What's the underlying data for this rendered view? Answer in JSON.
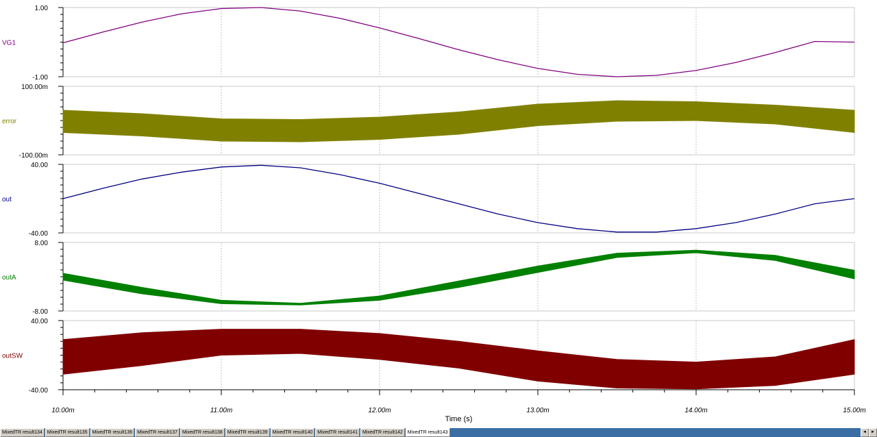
{
  "chart_data": {
    "type": "line",
    "xlabel": "Time (s)",
    "x_ticks": [
      "10.00m",
      "11.00m",
      "12.00m",
      "13.00m",
      "14.00m",
      "15.00m"
    ],
    "xlim": [
      0.01,
      0.015
    ],
    "panels": [
      {
        "name": "VG1",
        "color": "#800080",
        "render": "line",
        "ylim": [
          -1.0,
          1.0
        ],
        "y_tick_labels": [
          "1.00",
          "-1.00"
        ],
        "x": [
          0.01,
          0.01025,
          0.0105,
          0.01075,
          0.011,
          0.01125,
          0.0115,
          0.01175,
          0.012,
          0.01225,
          0.0125,
          0.01275,
          0.013,
          0.01325,
          0.0135,
          0.01375,
          0.014,
          0.01425,
          0.0145,
          0.01475,
          0.015
        ],
        "values": [
          -0.02,
          0.29,
          0.58,
          0.82,
          0.97,
          1.0,
          0.9,
          0.69,
          0.41,
          0.1,
          -0.22,
          -0.51,
          -0.76,
          -0.93,
          -1.0,
          -0.96,
          -0.82,
          -0.59,
          -0.3,
          0.02,
          0.0
        ]
      },
      {
        "name": "error",
        "color": "#808000",
        "render": "band",
        "ylim": [
          -100,
          100
        ],
        "y_tick_labels": [
          "100.00m",
          "-100.00m"
        ],
        "x": [
          0.01,
          0.0105,
          0.011,
          0.0115,
          0.012,
          0.0125,
          0.013,
          0.0135,
          0.014,
          0.0145,
          0.015
        ],
        "upper": [
          30,
          20,
          5,
          3,
          10,
          25,
          48,
          58,
          55,
          45,
          30
        ],
        "lower": [
          -35,
          -45,
          -60,
          -62,
          -55,
          -40,
          -15,
          -2,
          0,
          -10,
          -35
        ]
      },
      {
        "name": "out",
        "color": "#000080",
        "render": "line",
        "ylim": [
          -40,
          40
        ],
        "y_tick_labels": [
          "40.00",
          "-40.00"
        ],
        "x": [
          0.01,
          0.01025,
          0.0105,
          0.01075,
          0.011,
          0.01125,
          0.0115,
          0.01175,
          0.012,
          0.01225,
          0.0125,
          0.01275,
          0.013,
          0.01325,
          0.0135,
          0.01375,
          0.014,
          0.01425,
          0.0145,
          0.01475,
          0.015
        ],
        "values": [
          0,
          12,
          23,
          31,
          37,
          39,
          36,
          28,
          18,
          6,
          -6,
          -18,
          -28,
          -35,
          -39,
          -39,
          -35,
          -28,
          -18,
          -6,
          0
        ]
      },
      {
        "name": "outA",
        "color": "#008000",
        "render": "band",
        "ylim": [
          -8,
          8
        ],
        "y_tick_labels": [
          "8.00",
          "-8.00"
        ],
        "x": [
          0.01,
          0.0105,
          0.011,
          0.0115,
          0.012,
          0.0125,
          0.013,
          0.0135,
          0.014,
          0.0145,
          0.015
        ],
        "upper": [
          0.8,
          -2.5,
          -5.5,
          -6.2,
          -4.5,
          -1.0,
          2.5,
          5.5,
          6.2,
          5.0,
          1.5
        ],
        "lower": [
          -0.8,
          -4.0,
          -6.3,
          -6.6,
          -5.5,
          -2.5,
          1.0,
          4.5,
          5.6,
          3.8,
          -0.5
        ]
      },
      {
        "name": "outSW",
        "color": "#800000",
        "render": "band",
        "ylim": [
          -40,
          40
        ],
        "y_tick_labels": [
          "40.00",
          "-40.00"
        ],
        "x": [
          0.01,
          0.0105,
          0.011,
          0.0115,
          0.012,
          0.0125,
          0.013,
          0.0135,
          0.014,
          0.0145,
          0.015
        ],
        "upper": [
          18,
          26,
          30,
          30,
          25,
          16,
          5,
          -5,
          -8,
          -2,
          18
        ],
        "lower": [
          -22,
          -12,
          0,
          2,
          -5,
          -15,
          -30,
          -38,
          -39,
          -35,
          -22
        ]
      }
    ]
  },
  "tabs": {
    "items": [
      "MixedTR result134",
      "MixedTR result135",
      "MixedTR result136",
      "MixedTR result137",
      "MixedTR result138",
      "MixedTR result139",
      "MixedTR result140",
      "MixedTR result141",
      "MixedTR result142",
      "MixedTR result143"
    ],
    "active_index": 9,
    "scroll_left": "◄",
    "scroll_right": "►"
  }
}
